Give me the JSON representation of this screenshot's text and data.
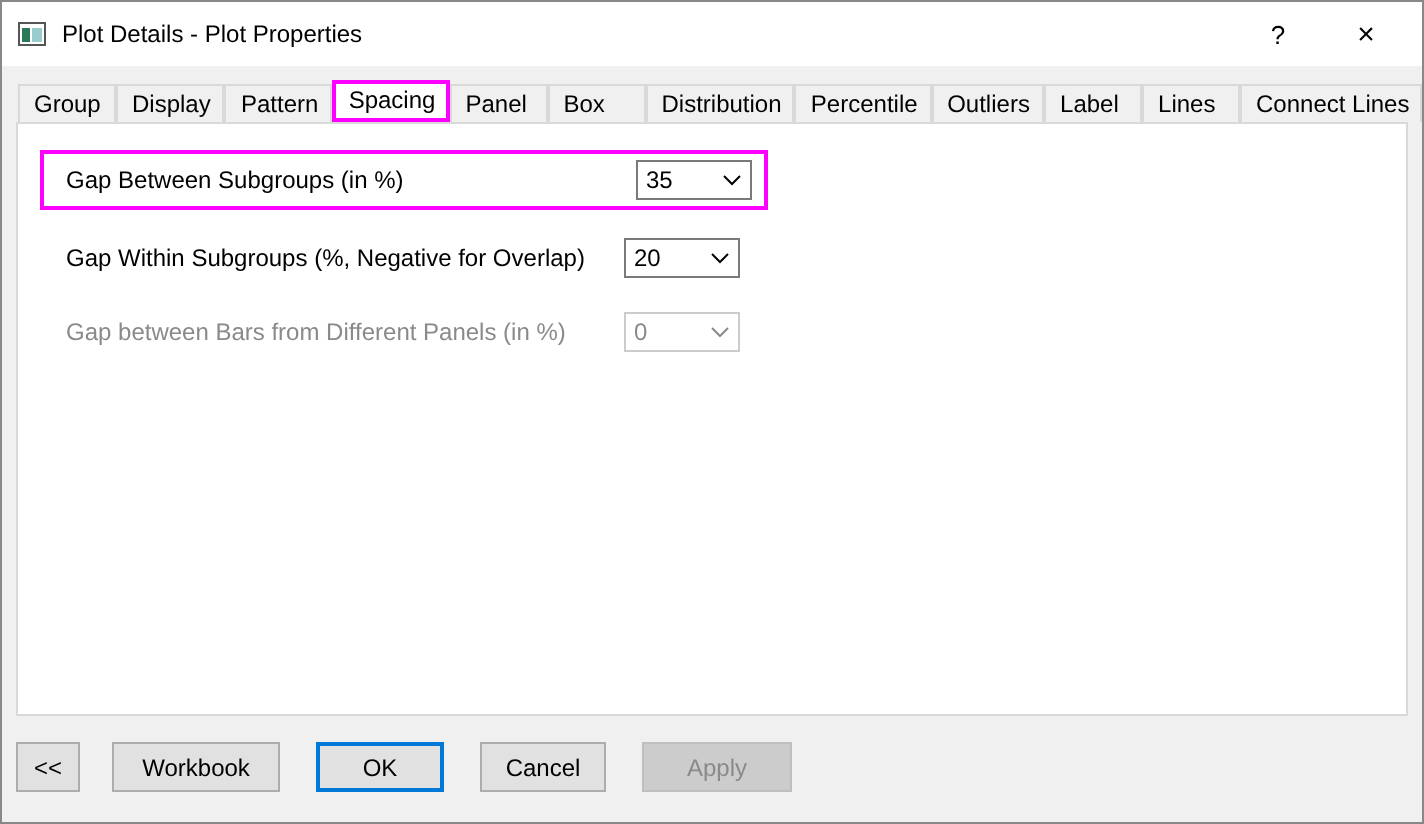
{
  "window": {
    "title": "Plot Details - Plot Properties",
    "help": "?",
    "close": "×"
  },
  "tabs": [
    {
      "label": "Group",
      "selected": false,
      "highlighted": false
    },
    {
      "label": "Display",
      "selected": false,
      "highlighted": false
    },
    {
      "label": "Pattern",
      "selected": false,
      "highlighted": false
    },
    {
      "label": "Spacing",
      "selected": true,
      "highlighted": true
    },
    {
      "label": "Panel",
      "selected": false,
      "highlighted": false
    },
    {
      "label": "Box",
      "selected": false,
      "highlighted": false
    },
    {
      "label": "Distribution",
      "selected": false,
      "highlighted": false
    },
    {
      "label": "Percentile",
      "selected": false,
      "highlighted": false
    },
    {
      "label": "Outliers",
      "selected": false,
      "highlighted": false
    },
    {
      "label": "Label",
      "selected": false,
      "highlighted": false
    },
    {
      "label": "Lines",
      "selected": false,
      "highlighted": false
    },
    {
      "label": "Connect Lines",
      "selected": false,
      "highlighted": false
    }
  ],
  "fields": [
    {
      "label": "Gap Between Subgroups (in %)",
      "value": "35",
      "disabled": false,
      "highlighted": true
    },
    {
      "label": "Gap Within Subgroups (%, Negative for Overlap)",
      "value": "20",
      "disabled": false,
      "highlighted": false
    },
    {
      "label": "Gap between Bars from Different Panels (in %)",
      "value": "0",
      "disabled": true,
      "highlighted": false
    }
  ],
  "buttons": [
    {
      "label": "<<",
      "default": false,
      "disabled": false
    },
    {
      "label": "Workbook",
      "default": false,
      "disabled": false
    },
    {
      "label": "OK",
      "default": true,
      "disabled": false
    },
    {
      "label": "Cancel",
      "default": false,
      "disabled": false
    },
    {
      "label": "Apply",
      "default": false,
      "disabled": true
    }
  ]
}
